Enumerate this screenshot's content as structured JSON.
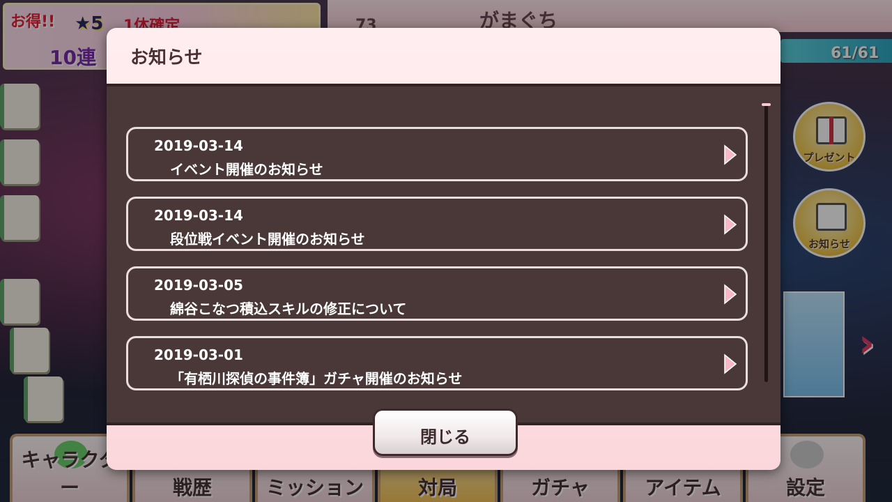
{
  "background": {
    "promo": {
      "deal": "お得!!",
      "star": "★5",
      "line1": "1体確定",
      "line2": "10連"
    },
    "header": {
      "title": "がまぐち",
      "left_number": "73"
    },
    "stamina": "61/61",
    "side_buttons": [
      {
        "label": "プレゼント",
        "icon": "gift-icon"
      },
      {
        "label": "お知らせ",
        "icon": "notice-icon"
      }
    ],
    "bottom_nav": [
      {
        "label": "キャラクター",
        "icon": "character-icon"
      },
      {
        "label": "戦歴",
        "icon": "history-icon"
      },
      {
        "label": "ミッション",
        "icon": "mission-icon"
      },
      {
        "label": "対局",
        "icon": "match-icon"
      },
      {
        "label": "ガチャ",
        "icon": "gacha-icon"
      },
      {
        "label": "アイテム",
        "icon": "item-icon"
      },
      {
        "label": "設定",
        "icon": "wrench-icon"
      }
    ]
  },
  "modal": {
    "title": "お知らせ",
    "items": [
      {
        "date": "2019-03-14",
        "title": "イベント開催のお知らせ"
      },
      {
        "date": "2019-03-14",
        "title": "段位戦イベント開催のお知らせ"
      },
      {
        "date": "2019-03-05",
        "title": "綿谷こなつ積込スキルの修正について"
      },
      {
        "date": "2019-03-01",
        "title": "「有栖川探偵の事件簿」ガチャ開催のお知らせ"
      }
    ],
    "close_label": "閉じる"
  },
  "colors": {
    "modal_panel": "#fbd7db",
    "list_background": "#4a3838",
    "arrow": "#f7b7c4",
    "text_light": "#ffffff"
  }
}
